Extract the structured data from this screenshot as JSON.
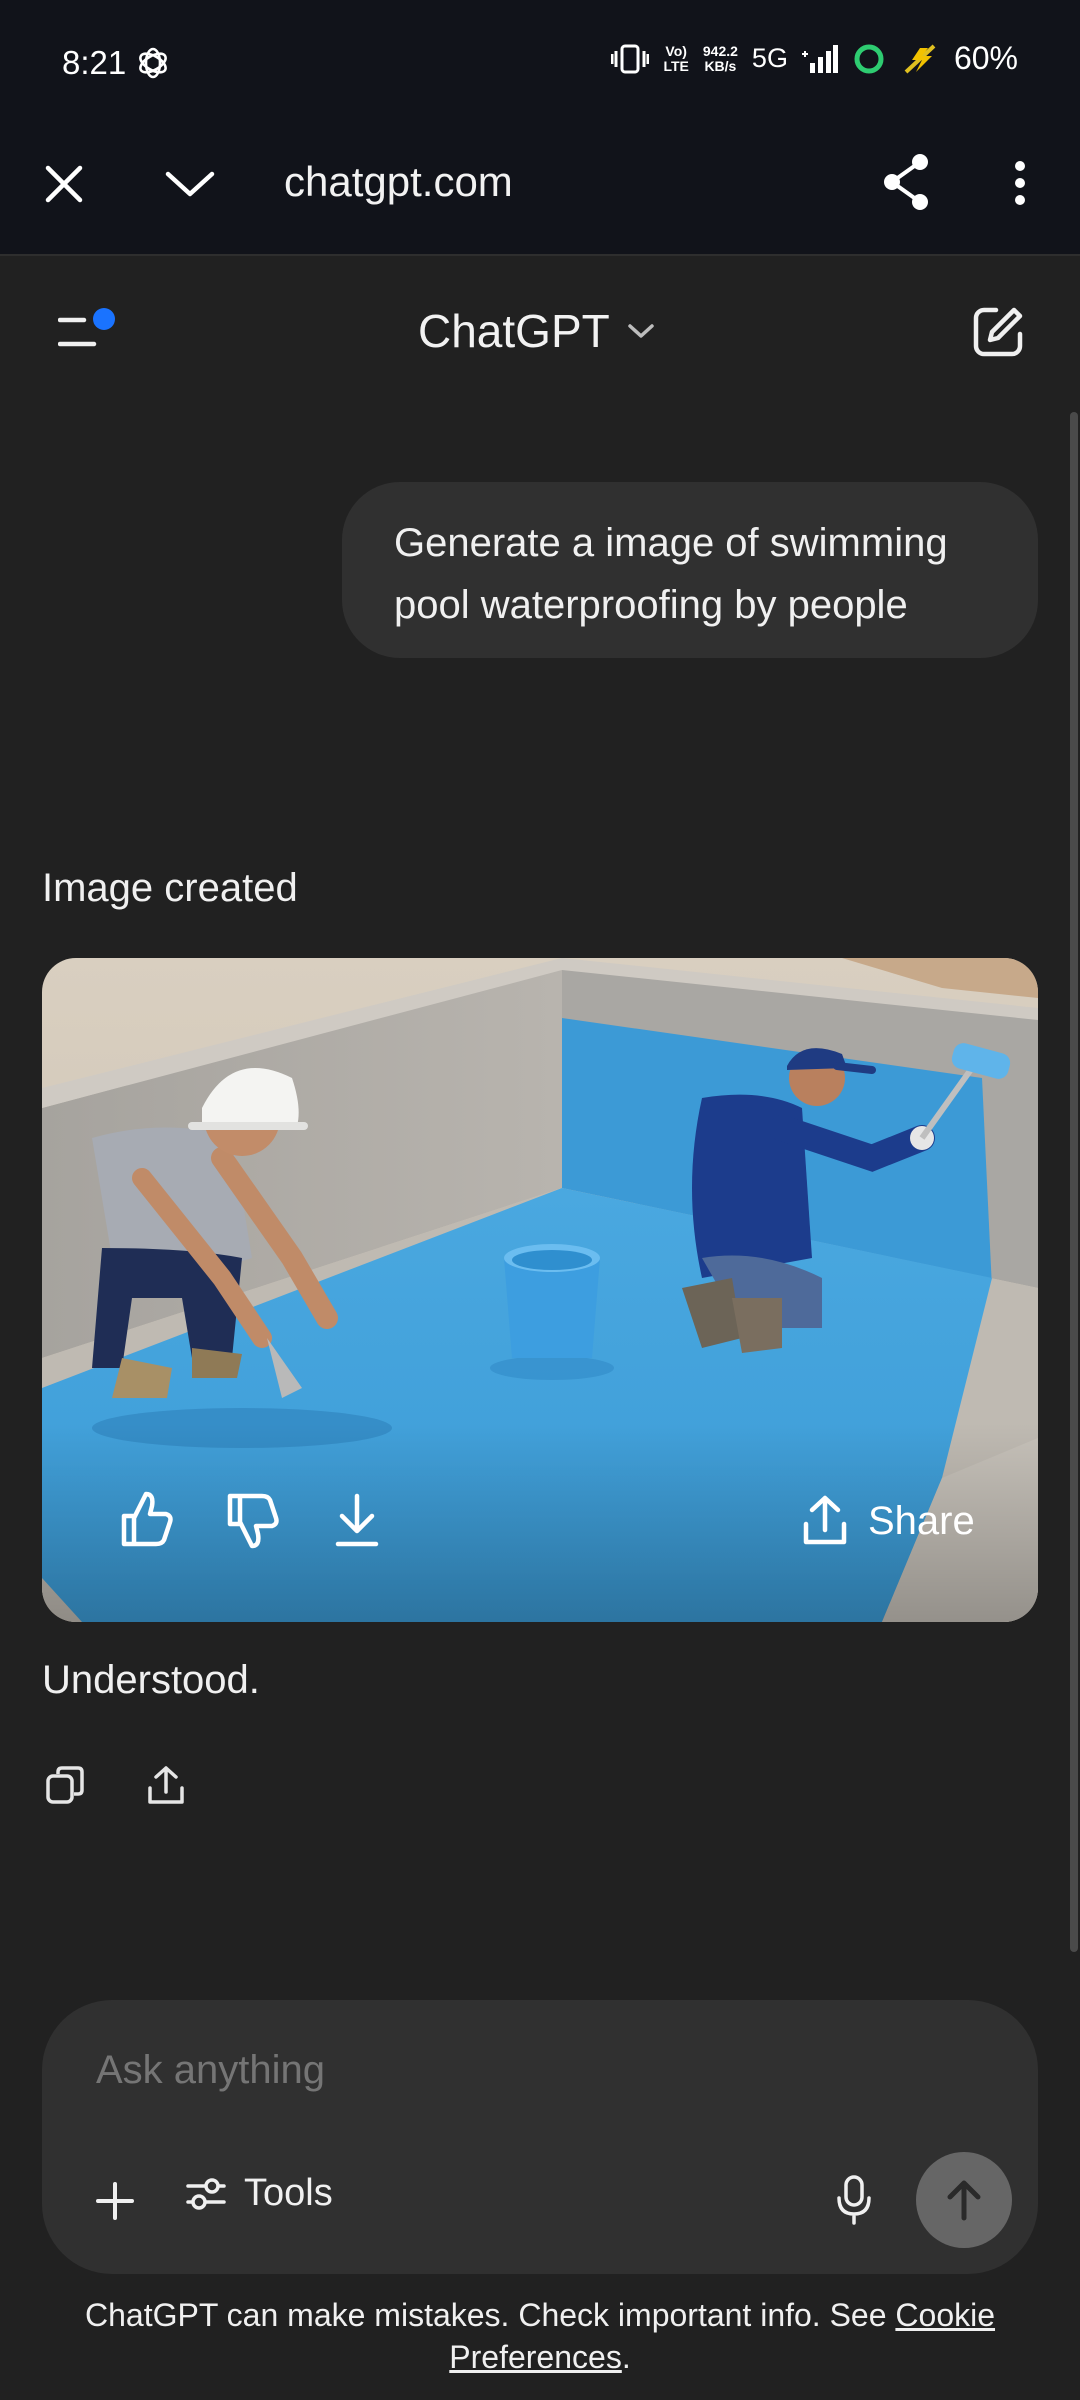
{
  "status_bar": {
    "time": "8:21",
    "volte_top": "Vo)",
    "volte_bottom": "LTE",
    "speed_value": "942.2",
    "speed_unit": "KB/s",
    "network": "5G",
    "battery": "60%"
  },
  "browser": {
    "url": "chatgpt.com"
  },
  "header": {
    "title": "ChatGPT"
  },
  "conversation": {
    "user_message": "Generate a image of swimming pool waterproofing by people",
    "image_caption": "Image created",
    "share_label": "Share",
    "assistant_text": "Understood."
  },
  "composer": {
    "placeholder": "Ask anything",
    "tools_label": "Tools"
  },
  "footer": {
    "disclaimer_text": "ChatGPT can make mistakes. Check important info. See ",
    "link_cookie": "Cookie",
    "link_preferences": "Preferences",
    "period": "."
  },
  "colors": {
    "background": "#212121",
    "status_bg": "#11131a",
    "bubble": "#303030",
    "accent_dot": "#1a73ff",
    "pool_blue": "#3d9fda"
  }
}
